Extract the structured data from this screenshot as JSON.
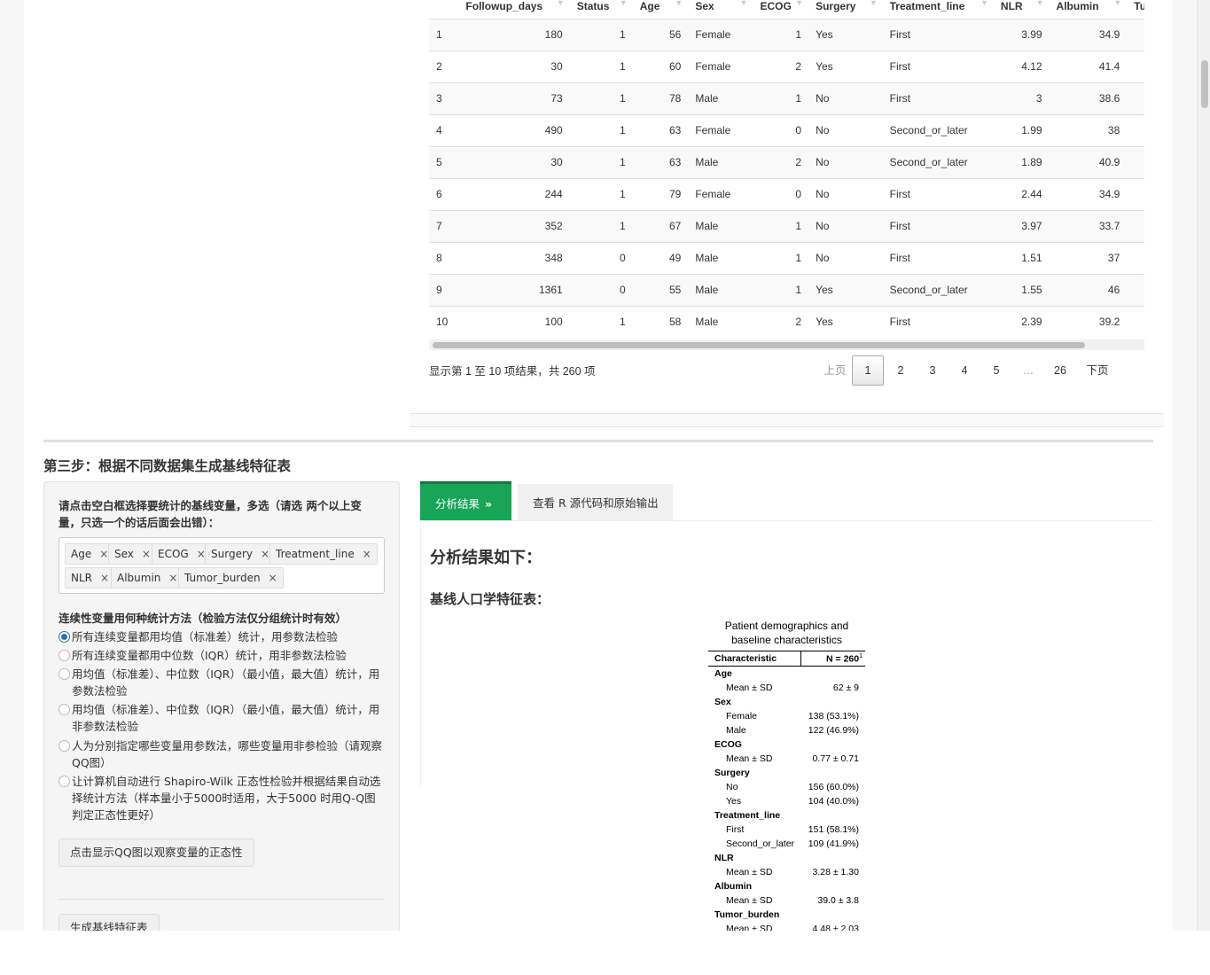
{
  "table": {
    "columns": [
      "",
      "Followup_days",
      "Status",
      "Age",
      "Sex",
      "ECOG",
      "Surgery",
      "Treatment_line",
      "NLR",
      "Albumin",
      "Tumor_"
    ],
    "rows": [
      [
        "1",
        "180",
        "1",
        "56",
        "Female",
        "1",
        "Yes",
        "First",
        "3.99",
        "34.9"
      ],
      [
        "2",
        "30",
        "1",
        "60",
        "Female",
        "2",
        "Yes",
        "First",
        "4.12",
        "41.4"
      ],
      [
        "3",
        "73",
        "1",
        "78",
        "Male",
        "1",
        "No",
        "First",
        "3",
        "38.6"
      ],
      [
        "4",
        "490",
        "1",
        "63",
        "Female",
        "0",
        "No",
        "Second_or_later",
        "1.99",
        "38"
      ],
      [
        "5",
        "30",
        "1",
        "63",
        "Male",
        "2",
        "No",
        "Second_or_later",
        "1.89",
        "40.9"
      ],
      [
        "6",
        "244",
        "1",
        "79",
        "Female",
        "0",
        "No",
        "First",
        "2.44",
        "34.9"
      ],
      [
        "7",
        "352",
        "1",
        "67",
        "Male",
        "1",
        "No",
        "First",
        "3.97",
        "33.7"
      ],
      [
        "8",
        "348",
        "0",
        "49",
        "Male",
        "1",
        "No",
        "First",
        "1.51",
        "37"
      ],
      [
        "9",
        "1361",
        "0",
        "55",
        "Male",
        "1",
        "Yes",
        "Second_or_later",
        "1.55",
        "46"
      ],
      [
        "10",
        "100",
        "1",
        "58",
        "Male",
        "2",
        "Yes",
        "First",
        "2.39",
        "39.2"
      ]
    ],
    "info": "显示第 1 至 10 项结果，共 260 项",
    "pager": {
      "prev": "上页",
      "pages": [
        "1",
        "2",
        "3",
        "4",
        "5",
        "…",
        "26"
      ],
      "current": "1",
      "next": "下页"
    }
  },
  "step3": {
    "title": "第三步：根据不同数据集生成基线特征表"
  },
  "left": {
    "select_label": "请点击空白框选择要统计的基线变量，多选（请选 两个以上变量，只选一个的话后面会出错）：",
    "chips": [
      "Age",
      "Sex",
      "ECOG",
      "Surgery",
      "Treatment_line",
      "NLR",
      "Albumin",
      "Tumor_burden"
    ],
    "chip_remove": "×",
    "method_label": "连续性变量用何种统计方法（检验方法仅分组统计时有效）",
    "radios": [
      "所有连续变量都用均值（标准差）统计，用参数法检验",
      "所有连续变量都用中位数（IQR）统计，用非参数法检验",
      "用均值（标准差）、中位数（IQR）（最小值，最大值）统计，用参数法检验",
      "用均值（标准差）、中位数（IQR）（最小值，最大值）统计，用非参数法检验",
      "人为分别指定哪些变量用参数法，哪些变量用非参检验（请观察QQ图）",
      "让计算机自动进行 Shapiro-Wilk 正态性检验并根据结果自动选择统计方法（样本量小于5000时适用，大于5000 时用Q-Q图判定正态性更好）"
    ],
    "qq_button": "点击显示QQ图以观察变量的正态性",
    "gen_button": "生成基线特征表"
  },
  "right": {
    "tab_active": "分析结果",
    "tab_inactive": "查看 R 源代码和原始输出",
    "heading": "分析结果如下：",
    "subheading": "基线人口学特征表："
  },
  "summary": {
    "title_line1": "Patient demographics and",
    "title_line2": "baseline characteristics",
    "col1": "Characteristic",
    "col2": "N = 260",
    "col2_sup": "1",
    "rows": [
      {
        "label": "Age",
        "value": "",
        "bold": true
      },
      {
        "label": "Mean ± SD",
        "value": "62 ± 9",
        "bold": false
      },
      {
        "label": "Sex",
        "value": "",
        "bold": true
      },
      {
        "label": "Female",
        "value": "138 (53.1%)",
        "bold": false
      },
      {
        "label": "Male",
        "value": "122 (46.9%)",
        "bold": false
      },
      {
        "label": "ECOG",
        "value": "",
        "bold": true
      },
      {
        "label": "Mean ± SD",
        "value": "0.77 ± 0.71",
        "bold": false
      },
      {
        "label": "Surgery",
        "value": "",
        "bold": true
      },
      {
        "label": "No",
        "value": "156 (60.0%)",
        "bold": false
      },
      {
        "label": "Yes",
        "value": "104 (40.0%)",
        "bold": false
      },
      {
        "label": "Treatment_line",
        "value": "",
        "bold": true
      },
      {
        "label": "First",
        "value": "151 (58.1%)",
        "bold": false
      },
      {
        "label": "Second_or_later",
        "value": "109 (41.9%)",
        "bold": false
      },
      {
        "label": "NLR",
        "value": "",
        "bold": true
      },
      {
        "label": "Mean ± SD",
        "value": "3.28 ± 1.30",
        "bold": false
      },
      {
        "label": "Albumin",
        "value": "",
        "bold": true
      },
      {
        "label": "Mean ± SD",
        "value": "39.0 ± 3.8",
        "bold": false
      },
      {
        "label": "Tumor_burden",
        "value": "",
        "bold": true
      },
      {
        "label": "Mean ± SD",
        "value": "4.48 ± 2.03",
        "bold": false
      }
    ]
  }
}
